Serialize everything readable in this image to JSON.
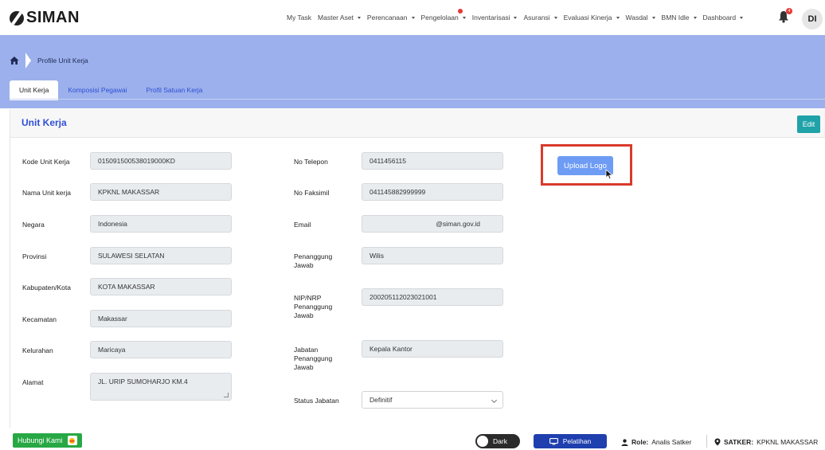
{
  "app": {
    "logo_text": "SIMAN"
  },
  "nav": {
    "items": [
      {
        "label": "My Task",
        "dropdown": false
      },
      {
        "label": "Master Aset",
        "dropdown": true
      },
      {
        "label": "Perencanaan",
        "dropdown": true
      },
      {
        "label": "Pengelolaan",
        "dropdown": true
      },
      {
        "label": "Inventarisasi",
        "dropdown": true
      },
      {
        "label": "Asuransi",
        "dropdown": true
      },
      {
        "label": "Evaluasi Kinerja",
        "dropdown": true
      },
      {
        "label": "Wasdal",
        "dropdown": true
      },
      {
        "label": "BMN Idle",
        "dropdown": true
      },
      {
        "label": "Dashboard",
        "dropdown": true
      }
    ],
    "notification_count": "4",
    "avatar_initials": "DI"
  },
  "breadcrumb": {
    "current": "Profile Unit Kerja"
  },
  "tabs": [
    {
      "label": "Unit Kerja",
      "active": true
    },
    {
      "label": "Komposisi Pegawai",
      "active": false
    },
    {
      "label": "Profil Satuan Kerja",
      "active": false
    }
  ],
  "card": {
    "title": "Unit Kerja",
    "edit_label": "Edit",
    "upload_label": "Upload Logo"
  },
  "left_fields": [
    {
      "label": "Kode Unit Kerja",
      "value": "015091500538019000KD"
    },
    {
      "label": "Nama Unit kerja",
      "value": "KPKNL MAKASSAR"
    },
    {
      "label": "Negara",
      "value": "Indonesia"
    },
    {
      "label": "Provinsi",
      "value": "SULAWESI SELATAN"
    },
    {
      "label": "Kabupaten/Kota",
      "value": "KOTA MAKASSAR"
    },
    {
      "label": "Kecamatan",
      "value": "Makassar"
    },
    {
      "label": "Kelurahan",
      "value": "Maricaya"
    },
    {
      "label": "Alamat",
      "value": "JL. URIP SUMOHARJO KM.4"
    }
  ],
  "right_fields": [
    {
      "label": "No Telepon",
      "value": "0411456115"
    },
    {
      "label": "No Faksimil",
      "value": "041145882999999"
    },
    {
      "label": "Email",
      "value": "@siman.gov.id"
    },
    {
      "label": "Penanggung Jawab",
      "value": "Wilis"
    },
    {
      "label": "NIP/NRP Penanggung Jawab",
      "value": "200205112023021001"
    },
    {
      "label": "Jabatan Penanggung Jawab",
      "value": "Kepala Kantor"
    },
    {
      "label": "Status Jabatan",
      "value": "Definitif"
    }
  ],
  "footer": {
    "contact_label": "Hubungi Kami",
    "dark_label": "Dark",
    "training_label": "Pelatihan",
    "role_key": "Role:",
    "role_value": "Analis Satker",
    "satker_key": "SATKER:",
    "satker_value": "KPKNL MAKASSAR"
  },
  "colors": {
    "band": "#9bb0ec",
    "accent": "#2f4fd6",
    "highlight_box": "#d93a2b",
    "upload_button": "#6e9cf5",
    "edit_button": "#1fa2a8",
    "contact_button": "#27a844",
    "training_button": "#1f3fae"
  }
}
